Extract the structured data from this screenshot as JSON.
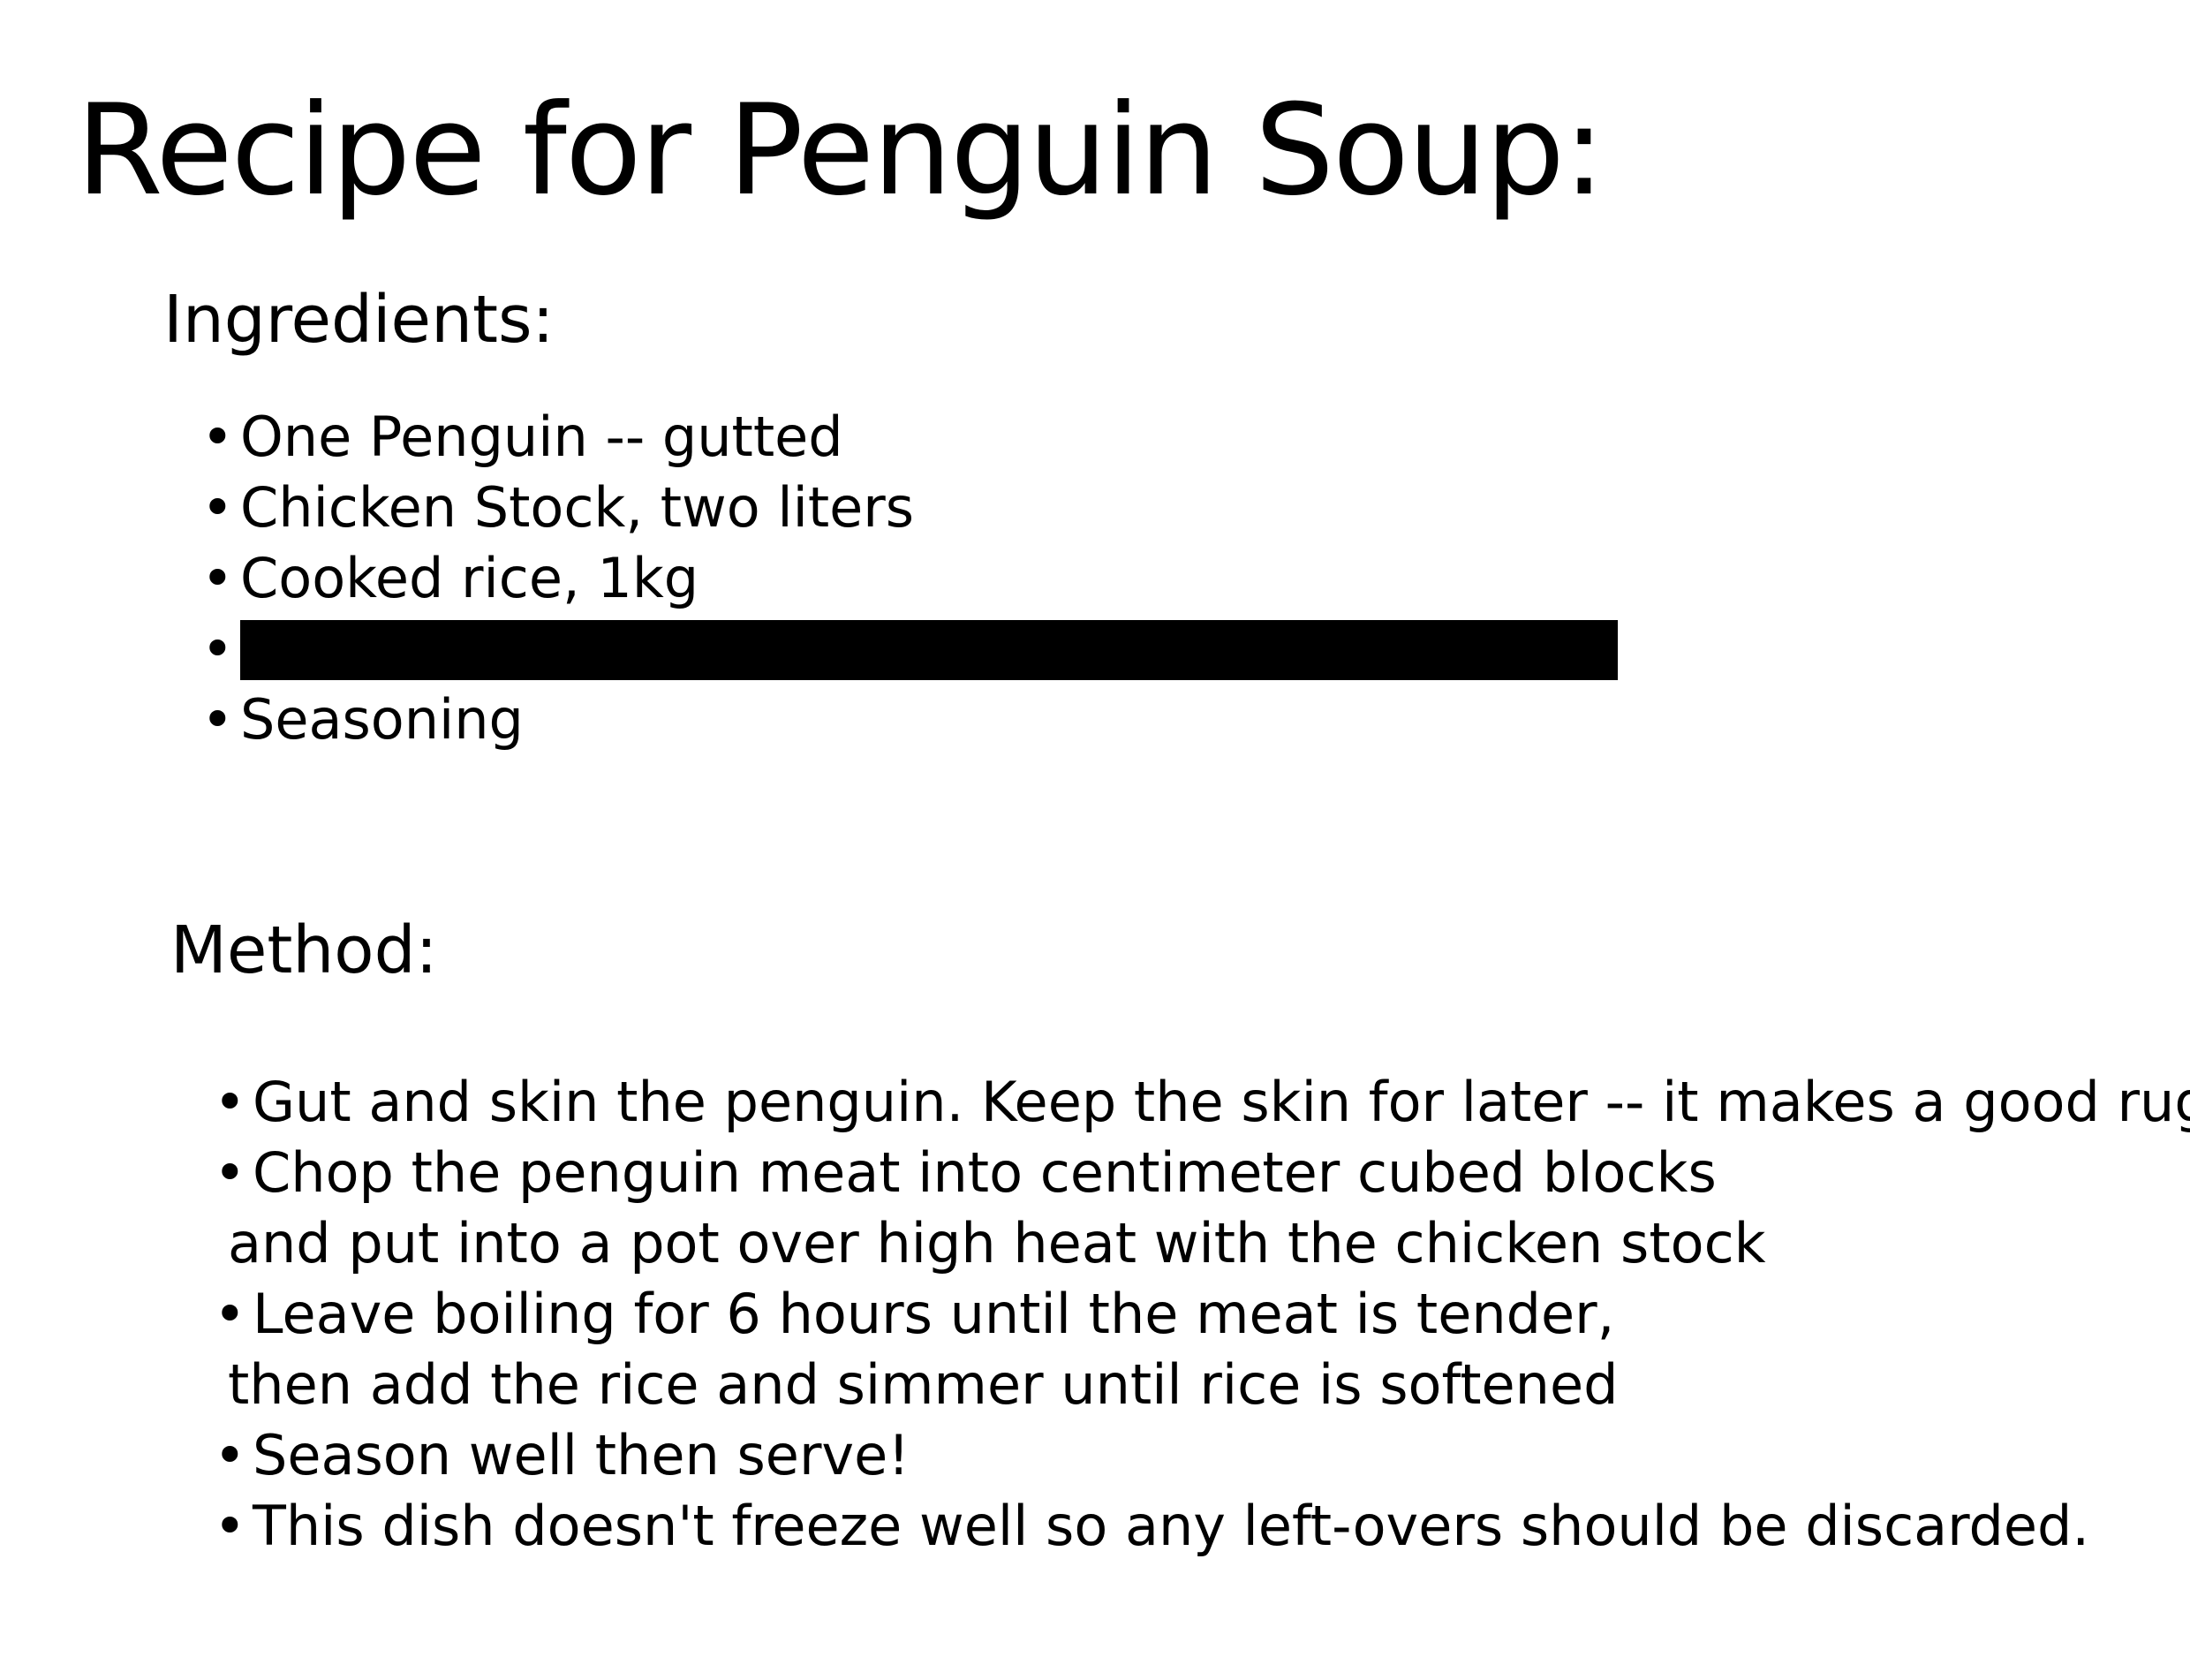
{
  "title": "Recipe for Penguin Soup:",
  "ingredients": {
    "heading": "Ingredients:",
    "bullet": "•",
    "items": [
      "One Penguin -- gutted",
      "Chicken Stock, two liters",
      "Cooked rice, 1kg",
      "",
      "Seasoning"
    ]
  },
  "method": {
    "heading": "Method:",
    "bullet": "•",
    "lines": [
      "Gut and skin the penguin. Keep the skin for later -- it makes a good rug.",
      "Chop the penguin meat into centimeter cubed blocks",
      "and put into a pot over high heat with the chicken stock",
      "Leave boiling for 6 hours until the meat is tender,",
      "then add the rice and simmer until rice is softened",
      "Season well then serve!",
      "This dish doesn't freeze well so any left-overs should be discarded."
    ]
  }
}
